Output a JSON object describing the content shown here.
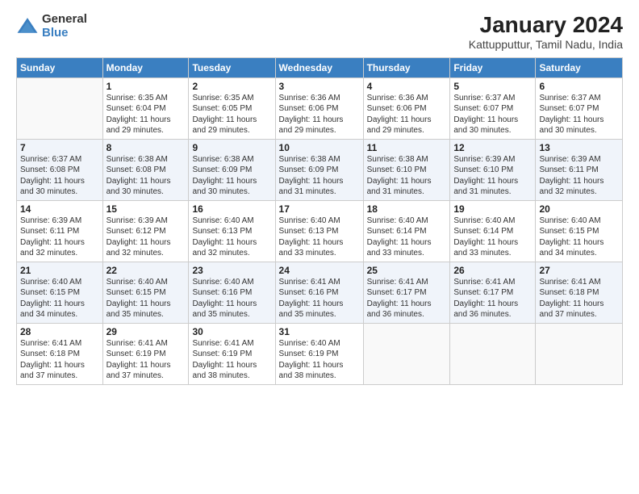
{
  "logo": {
    "general": "General",
    "blue": "Blue"
  },
  "header": {
    "title": "January 2024",
    "subtitle": "Kattupputtur, Tamil Nadu, India"
  },
  "days_of_week": [
    "Sunday",
    "Monday",
    "Tuesday",
    "Wednesday",
    "Thursday",
    "Friday",
    "Saturday"
  ],
  "weeks": [
    [
      {
        "num": "",
        "info": ""
      },
      {
        "num": "1",
        "info": "Sunrise: 6:35 AM\nSunset: 6:04 PM\nDaylight: 11 hours\nand 29 minutes."
      },
      {
        "num": "2",
        "info": "Sunrise: 6:35 AM\nSunset: 6:05 PM\nDaylight: 11 hours\nand 29 minutes."
      },
      {
        "num": "3",
        "info": "Sunrise: 6:36 AM\nSunset: 6:06 PM\nDaylight: 11 hours\nand 29 minutes."
      },
      {
        "num": "4",
        "info": "Sunrise: 6:36 AM\nSunset: 6:06 PM\nDaylight: 11 hours\nand 29 minutes."
      },
      {
        "num": "5",
        "info": "Sunrise: 6:37 AM\nSunset: 6:07 PM\nDaylight: 11 hours\nand 30 minutes."
      },
      {
        "num": "6",
        "info": "Sunrise: 6:37 AM\nSunset: 6:07 PM\nDaylight: 11 hours\nand 30 minutes."
      }
    ],
    [
      {
        "num": "7",
        "info": "Sunrise: 6:37 AM\nSunset: 6:08 PM\nDaylight: 11 hours\nand 30 minutes."
      },
      {
        "num": "8",
        "info": "Sunrise: 6:38 AM\nSunset: 6:08 PM\nDaylight: 11 hours\nand 30 minutes."
      },
      {
        "num": "9",
        "info": "Sunrise: 6:38 AM\nSunset: 6:09 PM\nDaylight: 11 hours\nand 30 minutes."
      },
      {
        "num": "10",
        "info": "Sunrise: 6:38 AM\nSunset: 6:09 PM\nDaylight: 11 hours\nand 31 minutes."
      },
      {
        "num": "11",
        "info": "Sunrise: 6:38 AM\nSunset: 6:10 PM\nDaylight: 11 hours\nand 31 minutes."
      },
      {
        "num": "12",
        "info": "Sunrise: 6:39 AM\nSunset: 6:10 PM\nDaylight: 11 hours\nand 31 minutes."
      },
      {
        "num": "13",
        "info": "Sunrise: 6:39 AM\nSunset: 6:11 PM\nDaylight: 11 hours\nand 32 minutes."
      }
    ],
    [
      {
        "num": "14",
        "info": "Sunrise: 6:39 AM\nSunset: 6:11 PM\nDaylight: 11 hours\nand 32 minutes."
      },
      {
        "num": "15",
        "info": "Sunrise: 6:39 AM\nSunset: 6:12 PM\nDaylight: 11 hours\nand 32 minutes."
      },
      {
        "num": "16",
        "info": "Sunrise: 6:40 AM\nSunset: 6:13 PM\nDaylight: 11 hours\nand 32 minutes."
      },
      {
        "num": "17",
        "info": "Sunrise: 6:40 AM\nSunset: 6:13 PM\nDaylight: 11 hours\nand 33 minutes."
      },
      {
        "num": "18",
        "info": "Sunrise: 6:40 AM\nSunset: 6:14 PM\nDaylight: 11 hours\nand 33 minutes."
      },
      {
        "num": "19",
        "info": "Sunrise: 6:40 AM\nSunset: 6:14 PM\nDaylight: 11 hours\nand 33 minutes."
      },
      {
        "num": "20",
        "info": "Sunrise: 6:40 AM\nSunset: 6:15 PM\nDaylight: 11 hours\nand 34 minutes."
      }
    ],
    [
      {
        "num": "21",
        "info": "Sunrise: 6:40 AM\nSunset: 6:15 PM\nDaylight: 11 hours\nand 34 minutes."
      },
      {
        "num": "22",
        "info": "Sunrise: 6:40 AM\nSunset: 6:15 PM\nDaylight: 11 hours\nand 35 minutes."
      },
      {
        "num": "23",
        "info": "Sunrise: 6:40 AM\nSunset: 6:16 PM\nDaylight: 11 hours\nand 35 minutes."
      },
      {
        "num": "24",
        "info": "Sunrise: 6:41 AM\nSunset: 6:16 PM\nDaylight: 11 hours\nand 35 minutes."
      },
      {
        "num": "25",
        "info": "Sunrise: 6:41 AM\nSunset: 6:17 PM\nDaylight: 11 hours\nand 36 minutes."
      },
      {
        "num": "26",
        "info": "Sunrise: 6:41 AM\nSunset: 6:17 PM\nDaylight: 11 hours\nand 36 minutes."
      },
      {
        "num": "27",
        "info": "Sunrise: 6:41 AM\nSunset: 6:18 PM\nDaylight: 11 hours\nand 37 minutes."
      }
    ],
    [
      {
        "num": "28",
        "info": "Sunrise: 6:41 AM\nSunset: 6:18 PM\nDaylight: 11 hours\nand 37 minutes."
      },
      {
        "num": "29",
        "info": "Sunrise: 6:41 AM\nSunset: 6:19 PM\nDaylight: 11 hours\nand 37 minutes."
      },
      {
        "num": "30",
        "info": "Sunrise: 6:41 AM\nSunset: 6:19 PM\nDaylight: 11 hours\nand 38 minutes."
      },
      {
        "num": "31",
        "info": "Sunrise: 6:40 AM\nSunset: 6:19 PM\nDaylight: 11 hours\nand 38 minutes."
      },
      {
        "num": "",
        "info": ""
      },
      {
        "num": "",
        "info": ""
      },
      {
        "num": "",
        "info": ""
      }
    ]
  ]
}
